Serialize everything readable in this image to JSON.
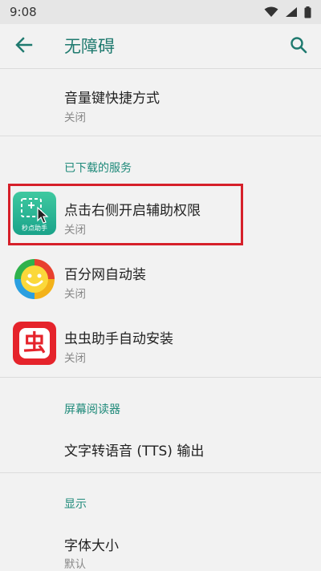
{
  "status_bar": {
    "time": "9:08",
    "icons": [
      "wifi-icon",
      "signal-icon",
      "battery-icon"
    ]
  },
  "app_bar": {
    "title": "无障碍",
    "back_icon": "back-arrow-icon",
    "search_icon": "search-icon"
  },
  "items": {
    "volume_shortcut": {
      "title": "音量键快捷方式",
      "subtitle": "关闭"
    },
    "downloaded_services_header": "已下载的服务",
    "service1": {
      "title": "点击右侧开启辅助权限",
      "subtitle": "关闭",
      "icon_label": "秒点助手"
    },
    "service2": {
      "title": "百分网自动装",
      "subtitle": "关闭"
    },
    "service3": {
      "title": "虫虫助手自动安装",
      "subtitle": "关闭",
      "icon_glyph": "虫"
    },
    "screen_reader_header": "屏幕阅读器",
    "tts": {
      "title": "文字转语音 (TTS) 输出"
    },
    "display_header": "显示",
    "font_size": {
      "title": "字体大小",
      "subtitle": "默认"
    }
  },
  "colors": {
    "accent": "#1f7a6f",
    "highlight": "#d6202a",
    "status_bar_bg": "#e6e6e6",
    "background": "#f2f2f2"
  }
}
